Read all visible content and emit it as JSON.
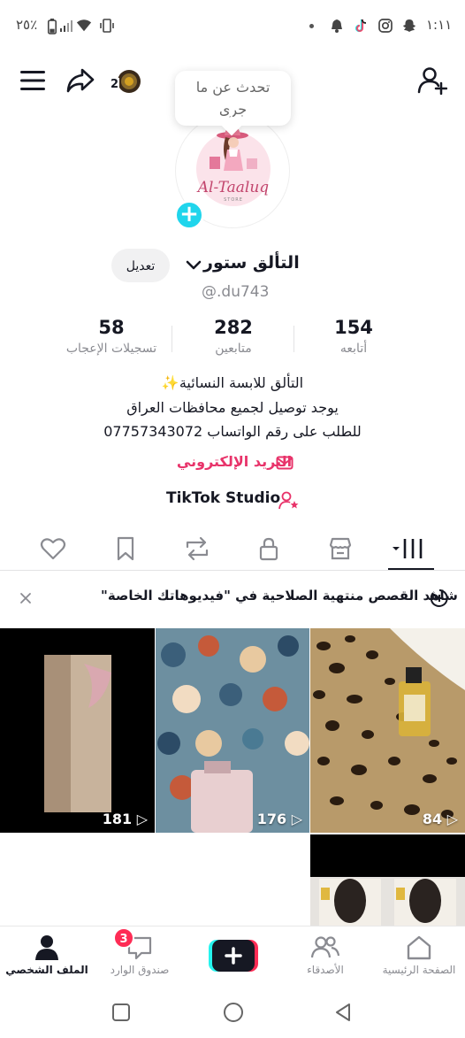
{
  "status_bar": {
    "time": "١:١١",
    "battery": "٢٥٪"
  },
  "header": {
    "notification_count": "2",
    "bubble_text_line1": "تحدث عن ما",
    "bubble_text_line2": "جرى"
  },
  "profile": {
    "avatar_brand": "Al-Taaluq",
    "avatar_sub": "STORE",
    "name": "التألق ستور",
    "edit_label": "تعديل",
    "handle": "@.du743",
    "stats": [
      {
        "value": "58",
        "label": "تسجيلات الإعجاب"
      },
      {
        "value": "282",
        "label": "متابعين"
      },
      {
        "value": "154",
        "label": "أتابعه"
      }
    ],
    "bio_line1": "التألق للابسة النسائية✨",
    "bio_line2": "يوجد توصيل لجميع محافظات العراق",
    "bio_line3": "للطلب على رقم الواتساب 07757343072",
    "email_label": "البريد الإلكتروني",
    "studio_label": "TikTok Studio"
  },
  "tabs": [
    "videos-grid",
    "shop",
    "private",
    "reposts",
    "favorites",
    "liked"
  ],
  "banner": {
    "text": "شاهد القصص منتهية الصلاحية في \"فيديوهاتك الخاصة\""
  },
  "videos": [
    {
      "views": "84"
    },
    {
      "views": "176"
    },
    {
      "views": "181"
    },
    {
      "views": ""
    }
  ],
  "bottom_nav": {
    "home": "الصفحة الرئيسية",
    "friends": "الأصدقاء",
    "inbox": "صندوق الوارد",
    "inbox_badge": "3",
    "profile": "الملف الشخصي"
  },
  "colors": {
    "accent_pink": "#fe2c55",
    "email_pink": "#e8336a",
    "cyan": "#20d5ec"
  }
}
